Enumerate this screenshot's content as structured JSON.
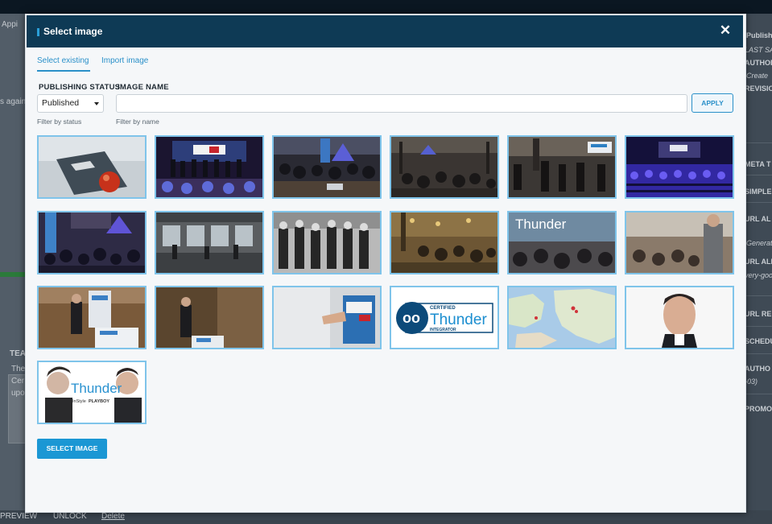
{
  "background": {
    "left_fragments": [
      "Appi",
      "s again",
      "TEA",
      "The",
      "Cer",
      "upo"
    ],
    "right_fragments": [
      "Published",
      "LAST SAVE",
      "AUTHOR:",
      "Create",
      "REVISION",
      "META T",
      "SIMPLE",
      "URL AL",
      "Generat",
      "URL ALIAS",
      "very-goo",
      "URL RE",
      "SCHEDU",
      "AUTHO",
      "-03)",
      "PROMO"
    ],
    "bottom_actions": {
      "preview": "PREVIEW",
      "unlock": "UNLOCK",
      "delete": "Delete"
    }
  },
  "modal": {
    "title": "Select image",
    "close_glyph": "✕",
    "tabs": [
      {
        "label": "Select existing",
        "active": true
      },
      {
        "label": "Import image",
        "active": false
      }
    ],
    "filters": {
      "status_label": "PUBLISHING STATUS",
      "status_value": "Published",
      "status_help": "Filter by status",
      "name_label": "IMAGE NAME",
      "name_value": "",
      "name_placeholder": "",
      "name_help": "Filter by name",
      "apply_label": "APPLY"
    },
    "images": [
      {
        "subject": "book-with-apple"
      },
      {
        "subject": "thunder-stage-group"
      },
      {
        "subject": "conference-audience-laptops"
      },
      {
        "subject": "venue-hall-crowd"
      },
      {
        "subject": "crowd-thunder-banner"
      },
      {
        "subject": "stage-audience-purple"
      },
      {
        "subject": "thunder-banner-crowd"
      },
      {
        "subject": "hall-windows"
      },
      {
        "subject": "bw-group-photo"
      },
      {
        "subject": "warm-hall-crowd"
      },
      {
        "subject": "thunder-slide-audience"
      },
      {
        "subject": "speaker-audience"
      },
      {
        "subject": "speaker-podium"
      },
      {
        "subject": "speaker-stage"
      },
      {
        "subject": "hand-thunder-day-sign"
      },
      {
        "subject": "certified-thunder-integrator-logo",
        "logo": {
          "top": "CERTIFIED",
          "name": "Thunder",
          "bottom": "INTEGRATOR"
        }
      },
      {
        "subject": "europe-map"
      },
      {
        "subject": "man-portrait"
      },
      {
        "subject": "thunder-two-men-portrait",
        "logo": {
          "name": "Thunder",
          "partner1": "InStyle",
          "partner2": "PLAYBOY"
        }
      }
    ],
    "select_button": "SELECT IMAGE"
  },
  "colors": {
    "header": "#0e3a55",
    "accent": "#2a90c9",
    "thumb_border": "#7fc4ea",
    "primary_button": "#1b97d4"
  }
}
